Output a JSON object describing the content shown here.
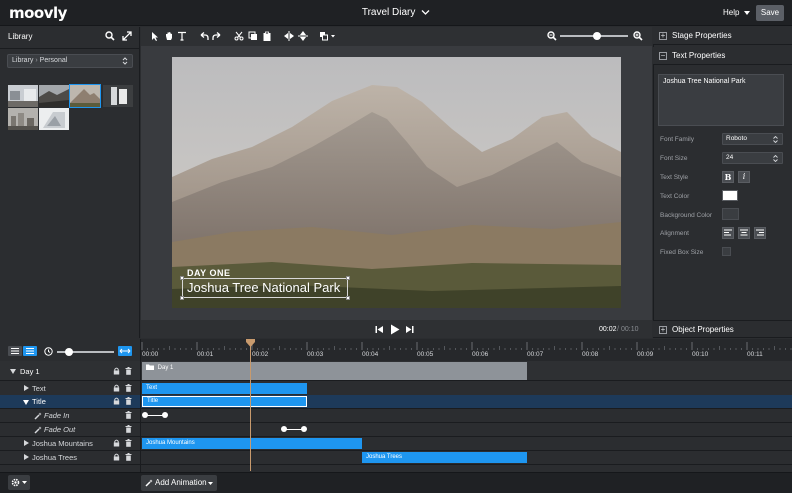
{
  "app": {
    "logo": "moovly",
    "project_title": "Travel Diary",
    "help_label": "Help",
    "save_label": "Save"
  },
  "library": {
    "title": "Library",
    "breadcrumb_root": "Library",
    "breadcrumb_child": "Personal"
  },
  "stage": {
    "overlay_small": "DAY ONE",
    "overlay_title": "Joshua Tree National Park",
    "time_current": "00:02",
    "time_separator": " / ",
    "time_total": "00:10",
    "zoom_level": 0.55
  },
  "properties": {
    "stage_header": "Stage Properties",
    "text_header": "Text Properties",
    "object_header": "Object Properties",
    "text_value": "Joshua Tree National Park",
    "font_family_label": "Font Family",
    "font_family_value": "Roboto",
    "font_size_label": "Font Size",
    "font_size_value": "24",
    "text_style_label": "Text Style",
    "bold_glyph": "B",
    "italic_glyph": "i",
    "text_color_label": "Text Color",
    "text_color": "#ffffff",
    "bg_color_label": "Background Color",
    "alignment_label": "Alignment",
    "fixed_box_label": "Fixed Box Size"
  },
  "timeline": {
    "ticks": [
      "00:00",
      "00:01",
      "00:02",
      "00:03",
      "00:04",
      "00:05",
      "00:06",
      "00:07",
      "00:08",
      "00:09",
      "00:10",
      "00:11"
    ],
    "tracks": [
      {
        "name": "Day 1"
      },
      {
        "name": "Text"
      },
      {
        "name": "Title"
      },
      {
        "name": "Fade In"
      },
      {
        "name": "Fade Out"
      },
      {
        "name": "Joshua Mountains"
      },
      {
        "name": "Joshua Trees"
      }
    ],
    "bars": {
      "day1": "Day 1",
      "text": "Text",
      "title": "Title",
      "mountains": "Joshua Mountains",
      "trees": "Joshua Trees"
    },
    "add_animation_label": "Add Animation"
  },
  "colors": {
    "accent": "#1e96f0",
    "selected_row": "#1d3a5a",
    "playhead": "#c89a6d"
  }
}
